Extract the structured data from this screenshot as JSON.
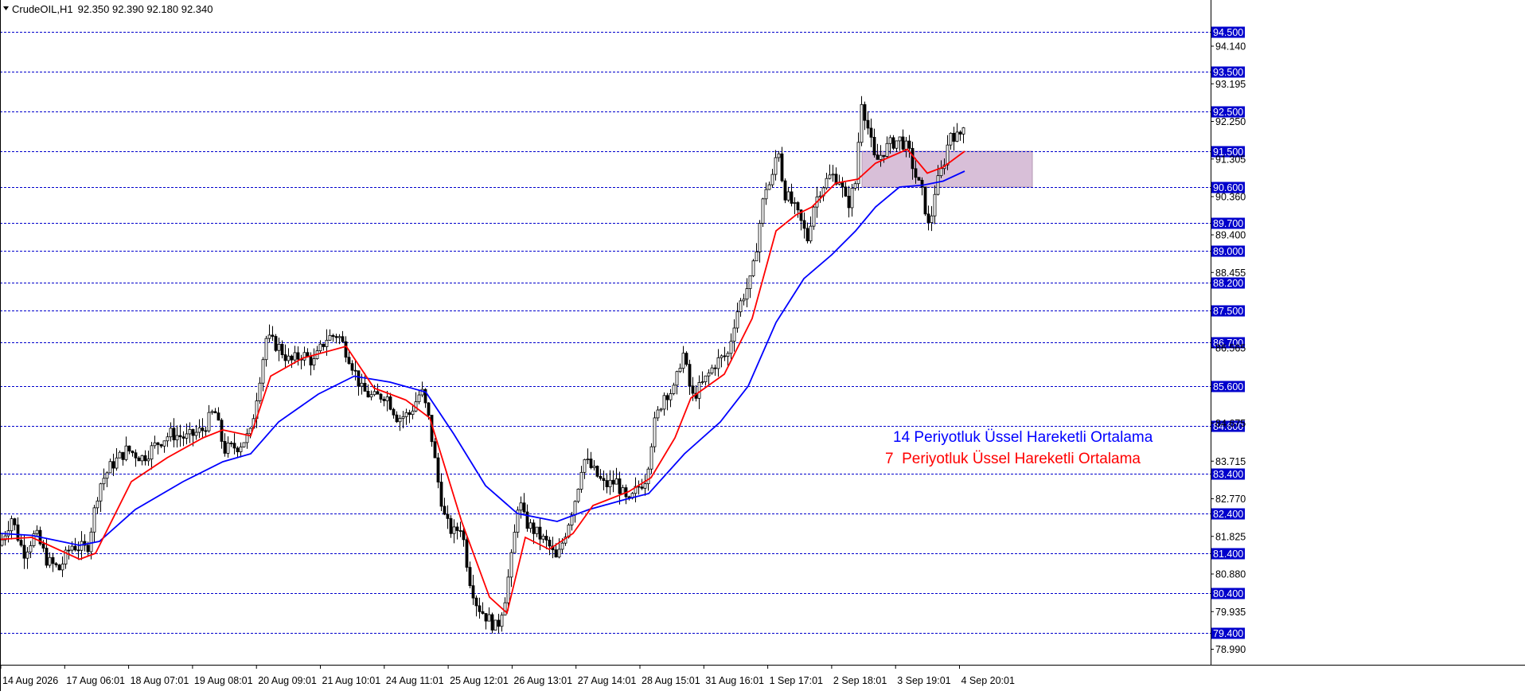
{
  "header": {
    "symbol": "CrudeOIL,H1",
    "ohlc": "92.350 92.390 92.180 92.340"
  },
  "colors": {
    "background": "#ffffff",
    "candle": "#000000",
    "level_line": "#0000cc",
    "level_label_bg": "#0000cc",
    "ema14": "#0000ff",
    "ema7": "#ff0000",
    "zone_fill": "#d8bfd8"
  },
  "icons": {
    "menu": "triangle-down-icon"
  },
  "chart_data": {
    "type": "candlestick",
    "title": "CrudeOIL,H1",
    "ylim": [
      78.6,
      95.3
    ],
    "price_ticks": [
      {
        "value": 94.14,
        "label": "94.140"
      },
      {
        "value": 93.195,
        "label": "93.195"
      },
      {
        "value": 92.25,
        "label": "92.250"
      },
      {
        "value": 91.305,
        "label": "91.305"
      },
      {
        "value": 90.36,
        "label": "90.360"
      },
      {
        "value": 89.4,
        "label": "89.400"
      },
      {
        "value": 88.455,
        "label": "88.455"
      },
      {
        "value": 86.565,
        "label": "86.565"
      },
      {
        "value": 84.675,
        "label": "84.675"
      },
      {
        "value": 83.715,
        "label": "83.715"
      },
      {
        "value": 82.77,
        "label": "82.770"
      },
      {
        "value": 81.825,
        "label": "81.825"
      },
      {
        "value": 80.88,
        "label": "80.880"
      },
      {
        "value": 79.935,
        "label": "79.935"
      },
      {
        "value": 78.99,
        "label": "78.990"
      }
    ],
    "levels": [
      {
        "value": 94.5,
        "label": "94.500"
      },
      {
        "value": 93.5,
        "label": "93.500"
      },
      {
        "value": 92.5,
        "label": "92.500"
      },
      {
        "value": 91.5,
        "label": "91.500"
      },
      {
        "value": 90.6,
        "label": "90.600"
      },
      {
        "value": 89.7,
        "label": "89.700"
      },
      {
        "value": 89.0,
        "label": "89.000"
      },
      {
        "value": 88.2,
        "label": "88.200"
      },
      {
        "value": 87.5,
        "label": "87.500"
      },
      {
        "value": 86.7,
        "label": "86.700"
      },
      {
        "value": 85.6,
        "label": "85.600"
      },
      {
        "value": 84.6,
        "label": "84.600"
      },
      {
        "value": 83.4,
        "label": "83.400"
      },
      {
        "value": 82.4,
        "label": "82.400"
      },
      {
        "value": 81.4,
        "label": "81.400"
      },
      {
        "value": 80.4,
        "label": "80.400"
      },
      {
        "value": 79.4,
        "label": "79.400"
      }
    ],
    "time_labels": [
      "14 Aug 2026",
      "17 Aug 06:01",
      "18 Aug 07:01",
      "19 Aug 08:01",
      "20 Aug 09:01",
      "21 Aug 10:01",
      "24 Aug 11:01",
      "25 Aug 12:01",
      "26 Aug 13:01",
      "27 Aug 14:01",
      "28 Aug 15:01",
      "31 Aug 16:01",
      "1 Sep 17:01",
      "2 Sep 18:01",
      "3 Sep 19:01",
      "4 Sep 20:01"
    ],
    "price_path": [
      [
        0,
        81.6
      ],
      [
        15,
        82.3
      ],
      [
        30,
        81.4
      ],
      [
        45,
        81.9
      ],
      [
        60,
        81.2
      ],
      [
        75,
        81.0
      ],
      [
        90,
        81.6
      ],
      [
        110,
        81.5
      ],
      [
        125,
        83.1
      ],
      [
        140,
        83.6
      ],
      [
        160,
        84.0
      ],
      [
        180,
        83.8
      ],
      [
        200,
        84.2
      ],
      [
        215,
        84.4
      ],
      [
        235,
        84.3
      ],
      [
        255,
        84.5
      ],
      [
        270,
        85.0
      ],
      [
        282,
        84.0
      ],
      [
        300,
        84.1
      ],
      [
        315,
        84.4
      ],
      [
        325,
        85.6
      ],
      [
        335,
        86.8
      ],
      [
        350,
        86.6
      ],
      [
        365,
        86.2
      ],
      [
        380,
        86.4
      ],
      [
        395,
        86.2
      ],
      [
        410,
        86.8
      ],
      [
        425,
        86.9
      ],
      [
        440,
        86.3
      ],
      [
        455,
        85.5
      ],
      [
        470,
        85.3
      ],
      [
        485,
        85.4
      ],
      [
        500,
        84.8
      ],
      [
        515,
        84.9
      ],
      [
        530,
        85.5
      ],
      [
        540,
        84.7
      ],
      [
        550,
        83.3
      ],
      [
        560,
        82.2
      ],
      [
        570,
        81.9
      ],
      [
        580,
        82.1
      ],
      [
        590,
        80.8
      ],
      [
        600,
        80.1
      ],
      [
        612,
        79.8
      ],
      [
        625,
        79.5
      ],
      [
        635,
        80.3
      ],
      [
        645,
        81.5
      ],
      [
        652,
        82.8
      ],
      [
        660,
        82.2
      ],
      [
        675,
        81.9
      ],
      [
        690,
        81.6
      ],
      [
        700,
        81.2
      ],
      [
        715,
        82.2
      ],
      [
        725,
        82.9
      ],
      [
        733,
        83.8
      ],
      [
        745,
        83.5
      ],
      [
        760,
        83.1
      ],
      [
        775,
        83.2
      ],
      [
        790,
        82.6
      ],
      [
        800,
        83.0
      ],
      [
        812,
        83.3
      ],
      [
        822,
        84.6
      ],
      [
        835,
        85.4
      ],
      [
        848,
        85.5
      ],
      [
        858,
        86.5
      ],
      [
        870,
        85.3
      ],
      [
        885,
        85.7
      ],
      [
        900,
        86.2
      ],
      [
        915,
        86.4
      ],
      [
        925,
        87.4
      ],
      [
        935,
        87.9
      ],
      [
        945,
        88.3
      ],
      [
        955,
        89.7
      ],
      [
        962,
        90.6
      ],
      [
        970,
        90.7
      ],
      [
        978,
        91.7
      ],
      [
        985,
        90.5
      ],
      [
        995,
        90.2
      ],
      [
        1005,
        89.8
      ],
      [
        1015,
        89.3
      ],
      [
        1022,
        90.1
      ],
      [
        1032,
        90.6
      ],
      [
        1045,
        90.9
      ],
      [
        1055,
        90.8
      ],
      [
        1065,
        90.1
      ],
      [
        1075,
        90.7
      ],
      [
        1083,
        92.8
      ],
      [
        1092,
        92.0
      ],
      [
        1100,
        91.2
      ],
      [
        1110,
        91.5
      ],
      [
        1120,
        91.7
      ],
      [
        1132,
        91.8
      ],
      [
        1142,
        91.5
      ],
      [
        1152,
        90.8
      ],
      [
        1160,
        90.4
      ],
      [
        1168,
        89.5
      ],
      [
        1175,
        90.5
      ],
      [
        1185,
        91.1
      ],
      [
        1195,
        92.0
      ],
      [
        1205,
        91.8
      ],
      [
        1212,
        92.3
      ]
    ],
    "ema14_path": [
      [
        0,
        81.9
      ],
      [
        40,
        81.85
      ],
      [
        100,
        81.6
      ],
      [
        125,
        81.7
      ],
      [
        170,
        82.5
      ],
      [
        230,
        83.2
      ],
      [
        280,
        83.7
      ],
      [
        315,
        83.9
      ],
      [
        350,
        84.7
      ],
      [
        400,
        85.4
      ],
      [
        445,
        85.85
      ],
      [
        490,
        85.7
      ],
      [
        535,
        85.45
      ],
      [
        570,
        84.4
      ],
      [
        610,
        83.1
      ],
      [
        650,
        82.4
      ],
      [
        700,
        82.2
      ],
      [
        740,
        82.5
      ],
      [
        785,
        82.75
      ],
      [
        815,
        82.9
      ],
      [
        860,
        83.9
      ],
      [
        905,
        84.7
      ],
      [
        940,
        85.6
      ],
      [
        975,
        87.2
      ],
      [
        1010,
        88.3
      ],
      [
        1045,
        88.9
      ],
      [
        1075,
        89.5
      ],
      [
        1100,
        90.1
      ],
      [
        1130,
        90.6
      ],
      [
        1160,
        90.65
      ],
      [
        1185,
        90.75
      ],
      [
        1212,
        91.0
      ]
    ],
    "ema7_path": [
      [
        0,
        81.75
      ],
      [
        40,
        81.8
      ],
      [
        100,
        81.25
      ],
      [
        120,
        81.4
      ],
      [
        165,
        83.2
      ],
      [
        210,
        83.8
      ],
      [
        255,
        84.3
      ],
      [
        280,
        84.5
      ],
      [
        315,
        84.35
      ],
      [
        340,
        85.85
      ],
      [
        380,
        86.3
      ],
      [
        435,
        86.6
      ],
      [
        470,
        85.55
      ],
      [
        510,
        85.25
      ],
      [
        540,
        84.8
      ],
      [
        580,
        82.2
      ],
      [
        615,
        80.3
      ],
      [
        637,
        79.9
      ],
      [
        660,
        81.8
      ],
      [
        690,
        81.5
      ],
      [
        720,
        81.9
      ],
      [
        745,
        82.6
      ],
      [
        790,
        82.95
      ],
      [
        818,
        83.3
      ],
      [
        848,
        84.3
      ],
      [
        868,
        85.3
      ],
      [
        910,
        85.9
      ],
      [
        945,
        87.3
      ],
      [
        975,
        89.5
      ],
      [
        1000,
        89.9
      ],
      [
        1020,
        90.1
      ],
      [
        1050,
        90.7
      ],
      [
        1078,
        90.8
      ],
      [
        1100,
        91.2
      ],
      [
        1140,
        91.55
      ],
      [
        1165,
        90.95
      ],
      [
        1185,
        91.1
      ],
      [
        1212,
        91.5
      ]
    ],
    "zone": {
      "x_start": 1083,
      "x_end": 1297,
      "y_low": 90.6,
      "y_high": 91.5
    },
    "legend": [
      {
        "label": "14 Periyotluk Üssel Hareketli Ortalama",
        "color": "#0000ff"
      },
      {
        "label": "7  Periyotluk Üssel Hareketli Ortalama",
        "color": "#ff0000"
      }
    ],
    "x_axis": "time (hourly bars)",
    "y_axis": "price",
    "grid": false
  }
}
